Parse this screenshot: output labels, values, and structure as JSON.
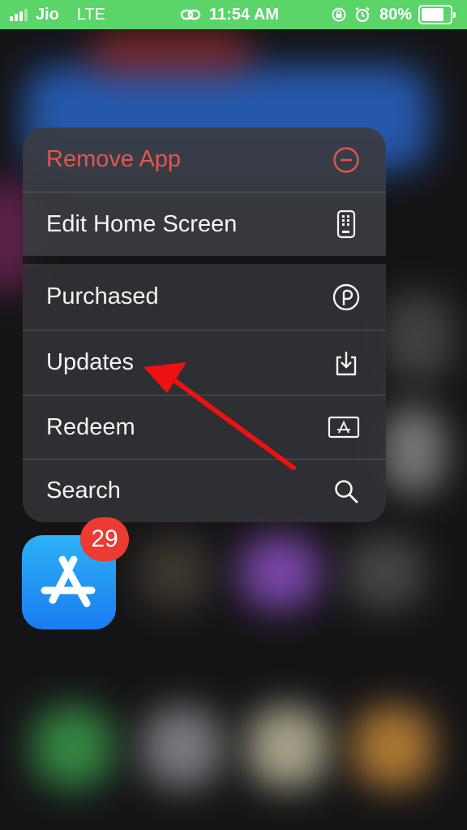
{
  "status_bar": {
    "carrier": "Jio",
    "network": "LTE",
    "time": "11:54 AM",
    "battery": "80%",
    "battery_level": 0.8,
    "icons": [
      "signal-icon",
      "link-icon",
      "orientation-lock-icon",
      "alarm-icon",
      "battery-icon"
    ]
  },
  "menu": {
    "items": [
      {
        "label": "Remove App",
        "icon": "minus-circle-icon",
        "color": "#e8544a"
      },
      {
        "label": "Edit Home Screen",
        "icon": "phone-apps-icon"
      },
      {
        "label": "Purchased",
        "icon": "purchased-icon"
      },
      {
        "label": "Updates",
        "icon": "download-tray-icon"
      },
      {
        "label": "Redeem",
        "icon": "redeem-card-icon"
      },
      {
        "label": "Search",
        "icon": "search-icon"
      }
    ]
  },
  "app_icon": {
    "name": "App Store",
    "badge": "29",
    "icon": "app-store-icon",
    "colors": {
      "top": "#2cb2f6",
      "bottom": "#1a7cf0",
      "badge": "#eb3b32"
    }
  },
  "annotation": {
    "icon": "red-arrow-icon",
    "color": "#ee1111"
  },
  "colors": {
    "status_bar": "#5bd46a",
    "destructive": "#e8544a",
    "menu_text": "#f4f4f6"
  }
}
